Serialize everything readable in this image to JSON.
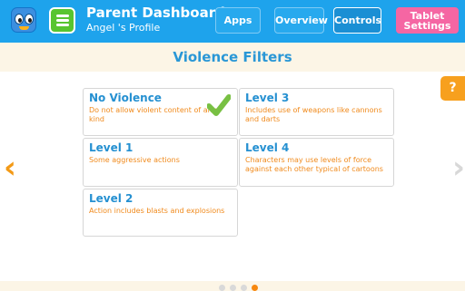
{
  "header": {
    "title": "Parent Dashboard",
    "profile": "Angel 's Profile",
    "nav": {
      "apps": "Apps",
      "overview": "Overview",
      "controls": "Controls",
      "tablet_line1": "Tablet",
      "tablet_line2": "Settings"
    }
  },
  "section": {
    "title": "Violence Filters"
  },
  "help_label": "?",
  "filters": [
    {
      "title": "No Violence",
      "desc": "Do not allow violent content of any kind",
      "selected": true
    },
    {
      "title": "Level 3",
      "desc": "Includes use of weapons like cannons and darts",
      "selected": false
    },
    {
      "title": "Level 1",
      "desc": "Some aggressive actions",
      "selected": false
    },
    {
      "title": "Level 4",
      "desc": "Characters may use levels of force against each other typical of cartoons",
      "selected": false
    },
    {
      "title": "Level 2",
      "desc": "Action includes blasts and explosions",
      "selected": false
    }
  ],
  "pagination": {
    "total": 4,
    "current": 4
  },
  "colors": {
    "header_bg": "#1ea3ec",
    "accent_orange": "#f39a17",
    "title_blue": "#2590d1",
    "tablet_pink": "#f566a3",
    "check_green": "#78c043"
  },
  "icons": {
    "logo": "face-logo-icon",
    "menu": "hamburger-menu-icon",
    "prev": "chevron-left-icon",
    "next": "chevron-right-icon",
    "selected": "checkmark-icon"
  }
}
